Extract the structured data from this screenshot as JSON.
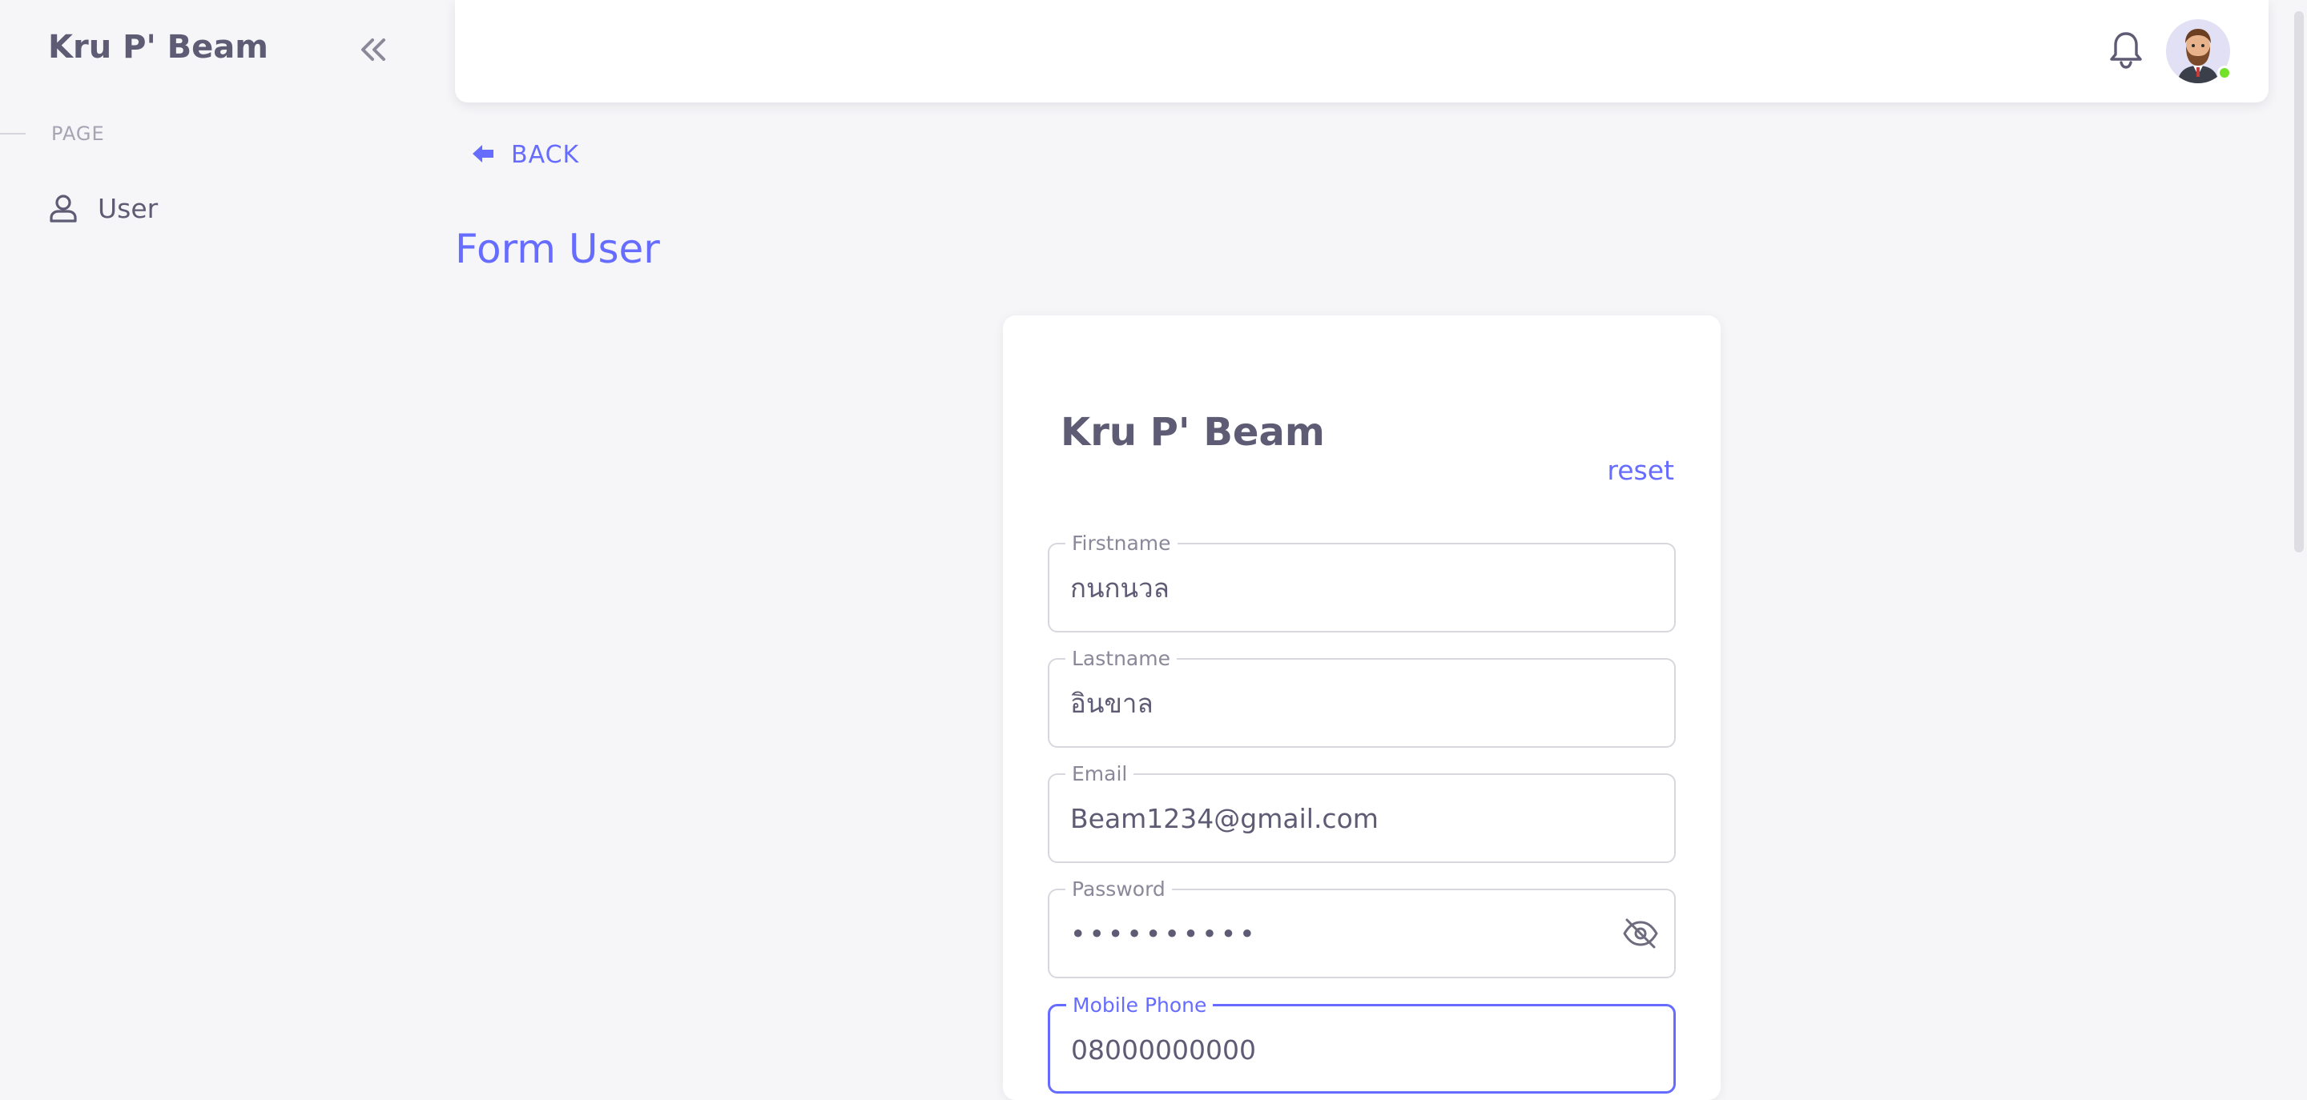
{
  "sidebar": {
    "brand": "Kru P' Beam",
    "section_label": "PAGE",
    "items": [
      {
        "label": "User",
        "icon": "user-icon"
      }
    ],
    "collapse_icon": "chevrons-left-icon"
  },
  "navbar": {
    "bell_icon": "bell-icon",
    "avatar": "avatar",
    "status_color": "#72e128"
  },
  "page": {
    "back_label": "BACK",
    "title": "Form User"
  },
  "card": {
    "title": "Kru P' Beam",
    "reset_label": "reset",
    "fields": {
      "firstname": {
        "label": "Firstname",
        "value": "กนกนวล"
      },
      "lastname": {
        "label": "Lastname",
        "value": "อินขาล"
      },
      "email": {
        "label": "Email",
        "value": "Beam1234@gmail.com"
      },
      "password": {
        "label": "Password",
        "value": "••••••••••"
      },
      "phone": {
        "label": "Mobile Phone",
        "value": "08000000000"
      }
    }
  },
  "colors": {
    "accent": "#666cff",
    "text": "#5e5b74",
    "background": "#f6f6f8"
  }
}
